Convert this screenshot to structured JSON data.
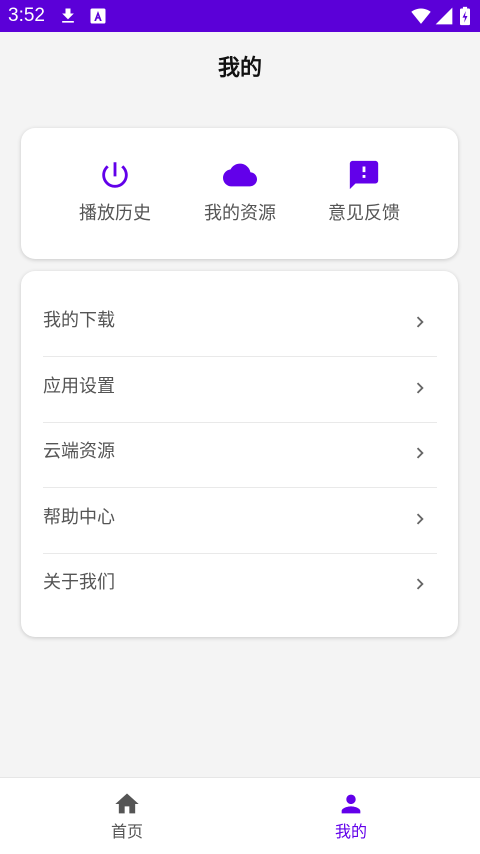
{
  "status_bar": {
    "time": "3:52",
    "background": "#5b00d8"
  },
  "header": {
    "title": "我的"
  },
  "quick_actions": [
    {
      "label": "播放历史",
      "icon": "power-icon"
    },
    {
      "label": "我的资源",
      "icon": "cloud-icon"
    },
    {
      "label": "意见反馈",
      "icon": "feedback-icon"
    }
  ],
  "menu": {
    "items": [
      {
        "label": "我的下载"
      },
      {
        "label": "应用设置"
      },
      {
        "label": "云端资源"
      },
      {
        "label": "帮助中心"
      },
      {
        "label": "关于我们"
      }
    ]
  },
  "bottom_nav": {
    "items": [
      {
        "label": "首页",
        "icon": "home-icon",
        "active": false
      },
      {
        "label": "我的",
        "icon": "person-icon",
        "active": true
      }
    ]
  },
  "colors": {
    "accent": "#6200ea",
    "inactive": "#555555"
  }
}
